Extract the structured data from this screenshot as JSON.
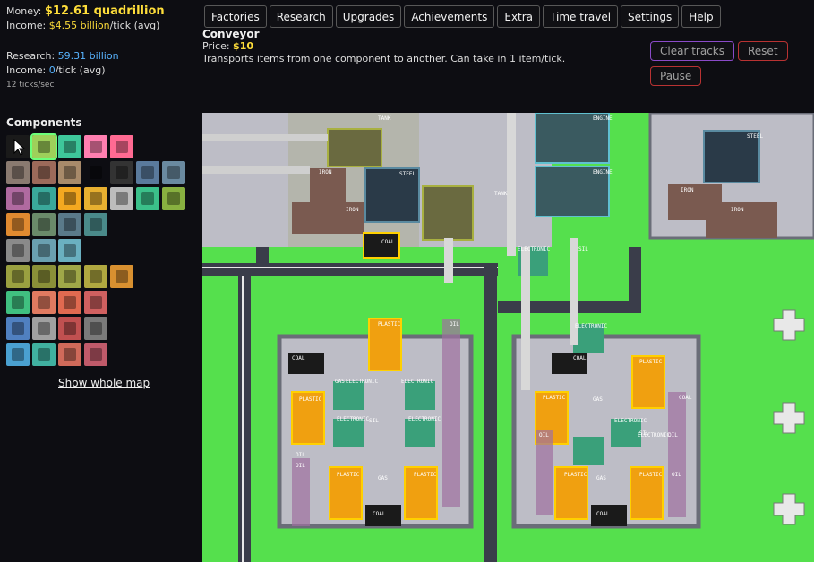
{
  "stats": {
    "money_label": "Money:",
    "money_value": "$12.61 quadrillion",
    "income_label": "Income:",
    "income_value": "$4.55 billion",
    "income_unit": "/tick (avg)",
    "research_label": "Research:",
    "research_value": "59.31 billion",
    "income2_label": "Income:",
    "income2_value": "0",
    "income2_unit": "/tick (avg)",
    "tick_rate": "12 ticks/sec"
  },
  "menu": [
    "Factories",
    "Research",
    "Upgrades",
    "Achievements",
    "Extra",
    "Time travel",
    "Settings",
    "Help"
  ],
  "component_info": {
    "name": "Conveyor",
    "price_label": "Price:",
    "price_value": "$10",
    "description": "Transports items from one component to another. Can take in 1 item/tick."
  },
  "controls": {
    "clear_tracks": "Clear tracks",
    "reset": "Reset",
    "pause": "Pause"
  },
  "components_title": "Components",
  "palette": [
    [
      {
        "icon": "cursor-icon",
        "color": "#1a1a1a"
      },
      {
        "icon": "conveyor-icon",
        "color": "#9ed05a",
        "selected": true
      },
      {
        "icon": "sorter-icon",
        "color": "#3ec79a"
      },
      {
        "icon": "buyer-icon",
        "color": "#ff7fb0"
      },
      {
        "icon": "seller-icon",
        "color": "#ff6a92"
      }
    ],
    [
      {
        "icon": "iron-mine-icon",
        "color": "#8a7a70"
      },
      {
        "icon": "iron-factory-icon",
        "color": "#9c6a5a"
      },
      {
        "icon": "iron-furnace-icon",
        "color": "#a88a6a"
      },
      {
        "icon": "empty",
        "color": "#0d0d12"
      },
      {
        "icon": "coal-mine-icon",
        "color": "#333"
      },
      {
        "icon": "steel-plant-icon",
        "color": "#5a7a9c"
      },
      {
        "icon": "steel-foundry-icon",
        "color": "#6a8aa0"
      }
    ],
    [
      {
        "icon": "oil-pump-icon",
        "color": "#b06aa0"
      },
      {
        "icon": "gas-plant-icon",
        "color": "#3aa89a"
      },
      {
        "icon": "plastic-factory-icon",
        "color": "#f4a820"
      },
      {
        "icon": "plastic-press-icon",
        "color": "#e8b030"
      },
      {
        "icon": "silicon-icon",
        "color": "#bcbcbc"
      },
      {
        "icon": "electronics-icon",
        "color": "#3bc08a"
      },
      {
        "icon": "circuit-icon",
        "color": "#88b040"
      }
    ],
    [
      {
        "icon": "engine-icon",
        "color": "#e08a30"
      },
      {
        "icon": "pipe-icon",
        "color": "#6a8a6a"
      },
      {
        "icon": "turbine-icon",
        "color": "#5a7a8a"
      },
      {
        "icon": "generator-icon",
        "color": "#4a8a8a"
      }
    ],
    [
      {
        "icon": "lab-icon",
        "color": "#8a8a8a"
      },
      {
        "icon": "rocket-icon",
        "color": "#6aa0b0"
      },
      {
        "icon": "satellite-icon",
        "color": "#6ab0c0"
      }
    ],
    [
      {
        "icon": "tank-icon",
        "color": "#9aa040"
      },
      {
        "icon": "armor-icon",
        "color": "#8a9038"
      },
      {
        "icon": "cannon-icon",
        "color": "#a0a848"
      },
      {
        "icon": "tank-factory-icon",
        "color": "#b0a840"
      },
      {
        "icon": "barrel-icon",
        "color": "#d89030"
      }
    ],
    [
      {
        "icon": "greenhouse-icon",
        "color": "#40c080"
      },
      {
        "icon": "drill-icon",
        "color": "#e07a60"
      },
      {
        "icon": "heater-icon",
        "color": "#e06a50"
      },
      {
        "icon": "crusher-icon",
        "color": "#d06060"
      }
    ],
    [
      {
        "icon": "battery-icon",
        "color": "#5080c0"
      },
      {
        "icon": "meter-icon",
        "color": "#a0a0a0"
      },
      {
        "icon": "computer-icon",
        "color": "#c05050"
      },
      {
        "icon": "server-icon",
        "color": "#7a7a7a"
      }
    ],
    [
      {
        "icon": "screen-icon",
        "color": "#4aa0d0"
      },
      {
        "icon": "monitor-icon",
        "color": "#40b0a0"
      },
      {
        "icon": "terminal-icon",
        "color": "#d06a5a"
      },
      {
        "icon": "console-icon",
        "color": "#c05a6a"
      }
    ]
  ],
  "show_whole_map": "Show whole map",
  "map": {
    "labels": [
      "TANK",
      "ENGINE",
      "ENGINE",
      "STEEL",
      "STEEL",
      "COAL",
      "IRON",
      "IRON",
      "IRON",
      "IRON",
      "TANK",
      "COAL",
      "ELECTRONIC",
      "SIL",
      "ELECTRONIC",
      "PLASTIC",
      "OIL",
      "COAL",
      "GAS",
      "ELECTRONIC",
      "ELECTRONIC",
      "PLASTIC",
      "ELECTRONIC",
      "ELECTRONIC",
      "SIL",
      "OIL",
      "OIL",
      "PLASTIC",
      "PLASTIC",
      "GAS",
      "COAL",
      "PLASTIC",
      "COAL",
      "ELECTRONIC",
      "GAS",
      "PLASTIC",
      "OIL",
      "ELECTRONIC",
      "SIL",
      "OIL",
      "OIL",
      "PLASTIC",
      "GAS",
      "PLASTIC",
      "COAL"
    ]
  },
  "colors": {
    "grass": "#55e04d",
    "road": "#3a3d4a",
    "factory_floor": "#bdbdc6",
    "money": "#ffde3a",
    "research": "#58b4ff"
  }
}
